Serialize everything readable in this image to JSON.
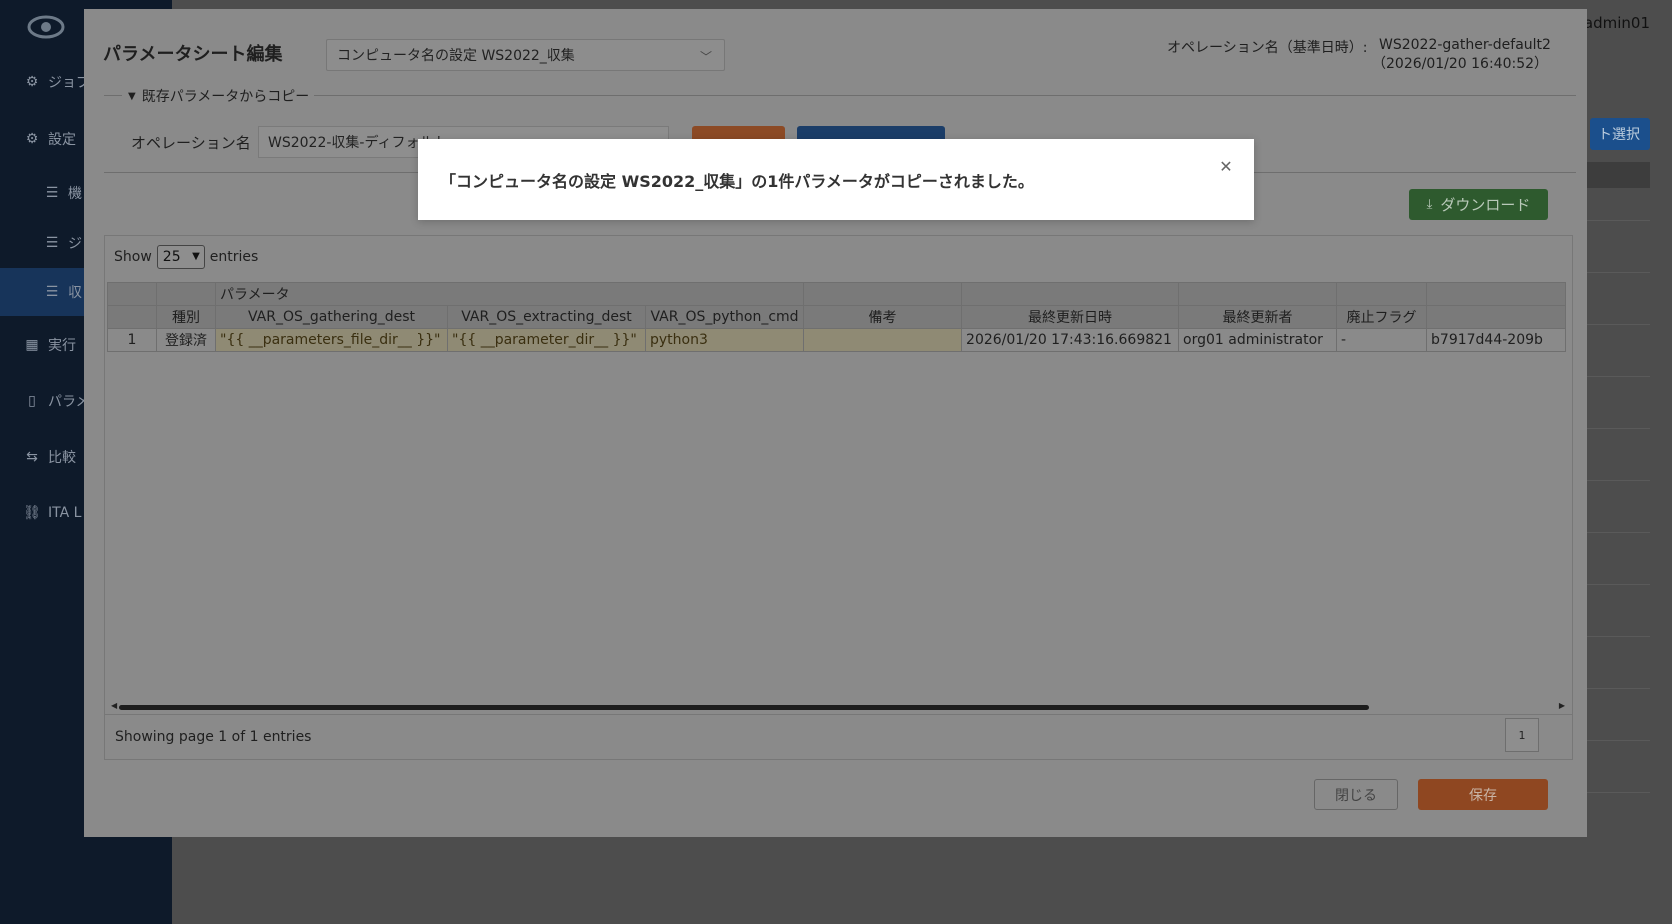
{
  "app": {
    "user": "admin01",
    "sidebar": [
      {
        "icon": "gear-icon",
        "label": "ジョブ"
      },
      {
        "icon": "gear-icon",
        "label": "設定"
      },
      {
        "icon": "sliders-icon",
        "label": "機"
      },
      {
        "icon": "sliders-icon",
        "label": "ジ"
      },
      {
        "icon": "sliders-icon",
        "label": "収"
      },
      {
        "icon": "grid-icon",
        "label": "実行"
      },
      {
        "icon": "document-icon",
        "label": "パラメ"
      },
      {
        "icon": "compare-icon",
        "label": "比較"
      },
      {
        "icon": "link-icon",
        "label": "ITA L"
      }
    ],
    "select_button": "ト選択"
  },
  "modal": {
    "title": "パラメータシート編集",
    "sheet_select": "コンピュータ名の設定 WS2022_収集",
    "operation_label": "オペレーション名（基準日時）:",
    "operation_value": "WS2022-gather-default2",
    "operation_date": "（2026/01/20 16:40:52）",
    "copy_section": "既存パラメータからコピー",
    "operation_name_label": "オペレーション名",
    "operation_name_value": "WS2022-収集-ディフォルト",
    "download_label": "ダウンロード",
    "show_label": "Show",
    "show_value": "25",
    "entries_label": "entries",
    "table": {
      "group_header": "パラメータ",
      "columns": [
        "",
        "種別",
        "VAR_OS_gathering_dest",
        "VAR_OS_extracting_dest",
        "VAR_OS_python_cmd",
        "備考",
        "最終更新日時",
        "最終更新者",
        "廃止フラグ",
        ""
      ],
      "rows": [
        [
          "1",
          "登録済",
          "\"{{ __parameters_file_dir__ }}\"",
          "\"{{ __parameter_dir__ }}\"",
          "python3",
          "",
          "2026/01/20 17:43:16.669821",
          "org01 administrator",
          "-",
          "b7917d44-209b"
        ]
      ]
    },
    "page_info": "Showing page 1 of 1 entries",
    "page_number": "1",
    "close_label": "閉じる",
    "save_label": "保存"
  },
  "notice": {
    "message": "「コンピュータ名の設定 WS2022_収集」の1件パラメータがコピーされました。"
  }
}
